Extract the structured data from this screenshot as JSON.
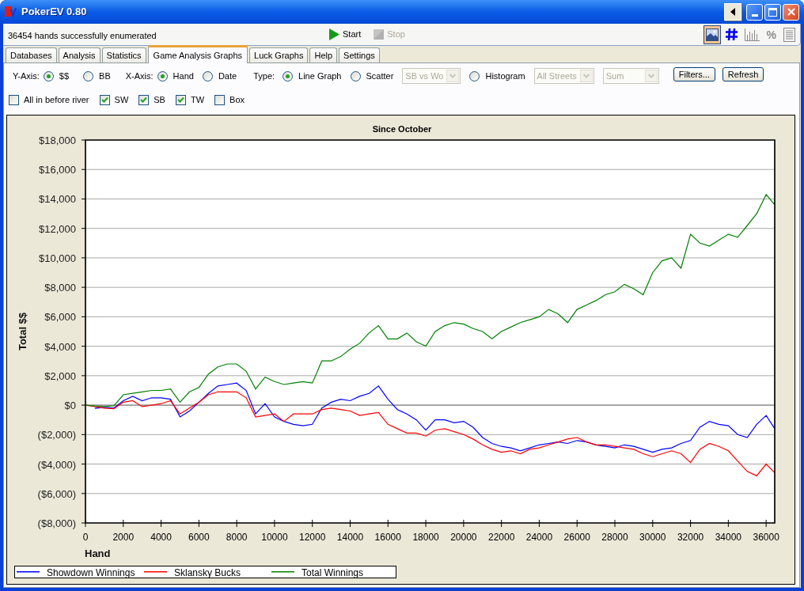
{
  "window": {
    "title": "PokerEV 0.80"
  },
  "status_bar": {
    "message": "36454 hands successfully enumerated",
    "actions": [
      {
        "kind": "start",
        "label": "Start",
        "disabled": false
      },
      {
        "kind": "stop",
        "label": "Stop",
        "disabled": true
      }
    ],
    "view_buttons": [
      {
        "kind": "picture",
        "selected": true
      },
      {
        "kind": "hash",
        "selected": false
      },
      {
        "kind": "bars",
        "selected": false
      },
      {
        "kind": "percent",
        "label": "%",
        "selected": false
      },
      {
        "kind": "list",
        "selected": false
      }
    ]
  },
  "tabs": [
    {
      "label": "Databases",
      "selected": false
    },
    {
      "label": "Analysis",
      "selected": false
    },
    {
      "label": "Statistics",
      "selected": false
    },
    {
      "label": "Game Analysis Graphs",
      "selected": true
    },
    {
      "label": "Luck Graphs",
      "selected": false
    },
    {
      "label": "Help",
      "selected": false
    },
    {
      "label": "Settings",
      "selected": false
    }
  ],
  "graph_options": {
    "y_axis": {
      "label": "Y-Axis:",
      "options": [
        {
          "label": "$$",
          "selected": true
        },
        {
          "label": "BB",
          "selected": false
        }
      ]
    },
    "x_axis": {
      "label": "X-Axis:",
      "options": [
        {
          "label": "Hand",
          "selected": true
        },
        {
          "label": "Date",
          "selected": false
        }
      ]
    },
    "type": {
      "label": "Type:",
      "controls": [
        {
          "kind": "radio",
          "label": "Line Graph",
          "selected": true
        },
        {
          "kind": "radio",
          "label": "Scatter",
          "selected": false
        },
        {
          "kind": "dropdown",
          "value": "SB vs Wo",
          "disabled": true
        },
        {
          "kind": "radio",
          "label": "Histogram",
          "selected": false
        },
        {
          "kind": "dropdown",
          "value": "All Streets",
          "disabled": true
        },
        {
          "kind": "dropdown",
          "value": "Sum",
          "disabled": true
        }
      ]
    },
    "buttons": [
      {
        "label": "Filters..."
      },
      {
        "label": "Refresh"
      }
    ],
    "checkboxes": [
      {
        "label": "All in before river",
        "checked": false
      },
      {
        "label": "SW",
        "checked": true
      },
      {
        "label": "SB",
        "checked": true
      },
      {
        "label": "TW",
        "checked": true
      },
      {
        "label": "Box",
        "checked": false
      }
    ]
  },
  "chart": {
    "chart_data": {
      "type": "line",
      "title": "Since October",
      "xlabel": "Hand",
      "ylabel": "Total $$",
      "grid": true,
      "legend": "bottom",
      "x": [
        0,
        500,
        1000,
        1500,
        2000,
        2500,
        3000,
        3500,
        4000,
        4500,
        5000,
        5500,
        6000,
        6500,
        7000,
        7500,
        8000,
        8500,
        9000,
        9500,
        10000,
        10500,
        11000,
        11500,
        12000,
        12500,
        13000,
        13500,
        14000,
        14500,
        15000,
        15500,
        16000,
        16500,
        17000,
        17500,
        18000,
        18500,
        19000,
        19500,
        20000,
        20500,
        21000,
        21500,
        22000,
        22500,
        23000,
        23500,
        24000,
        24500,
        25000,
        25500,
        26000,
        26500,
        27000,
        27500,
        28000,
        28500,
        29000,
        29500,
        30000,
        30500,
        31000,
        31500,
        32000,
        32500,
        33000,
        33500,
        34000,
        34500,
        35000,
        35500,
        36000,
        36454
      ],
      "series": [
        {
          "name": "Showdown Winnings",
          "color": "#0000ff",
          "values": [
            null,
            -220,
            -150,
            -200,
            300,
            600,
            300,
            500,
            500,
            400,
            -800,
            -400,
            200,
            800,
            1300,
            1400,
            1500,
            1000,
            -600,
            100,
            -800,
            -1100,
            -1300,
            -1400,
            -1300,
            -200,
            200,
            400,
            300,
            600,
            800,
            1300,
            400,
            -300,
            -600,
            -1000,
            -1700,
            -1000,
            -1000,
            -1200,
            -1100,
            -1500,
            -2200,
            -2600,
            -2800,
            -2900,
            -3100,
            -2900,
            -2700,
            -2600,
            -2500,
            -2600,
            -2400,
            -2500,
            -2700,
            -2800,
            -2900,
            -2700,
            -2800,
            -3000,
            -3200,
            -3000,
            -2900,
            -2600,
            -2400,
            -1500,
            -1100,
            -1300,
            -1400,
            -2000,
            -2200,
            -1300,
            -700,
            -1600
          ]
        },
        {
          "name": "Sklansky Bucks",
          "color": "#ff0000",
          "values": [
            0,
            -100,
            -200,
            -250,
            200,
            300,
            -100,
            0,
            100,
            300,
            -600,
            -200,
            200,
            700,
            900,
            900,
            900,
            500,
            -800,
            -700,
            -600,
            -1100,
            -600,
            -600,
            -600,
            -300,
            -200,
            -300,
            -400,
            -700,
            -600,
            -500,
            -1300,
            -1600,
            -1900,
            -1900,
            -2100,
            -1700,
            -1600,
            -1800,
            -2000,
            -2300,
            -2700,
            -3000,
            -3200,
            -3100,
            -3300,
            -3000,
            -2900,
            -2700,
            -2500,
            -2300,
            -2200,
            -2500,
            -2700,
            -2700,
            -2800,
            -2900,
            -3000,
            -3300,
            -3500,
            -3300,
            -3100,
            -3300,
            -3900,
            -3000,
            -2600,
            -2800,
            -3100,
            -3800,
            -4500,
            -4800,
            -4000,
            -4600
          ]
        },
        {
          "name": "Total Winnings",
          "color": "#008000",
          "values": [
            0,
            -50,
            -100,
            -50,
            700,
            800,
            900,
            1000,
            1000,
            1100,
            200,
            900,
            1200,
            2100,
            2600,
            2800,
            2800,
            2300,
            1100,
            1900,
            1600,
            1400,
            1500,
            1600,
            1500,
            3000,
            3000,
            3300,
            3800,
            4200,
            4900,
            5400,
            4500,
            4500,
            4900,
            4300,
            4000,
            5000,
            5400,
            5600,
            5500,
            5200,
            5000,
            4500,
            5000,
            5300,
            5600,
            5800,
            6000,
            6500,
            6200,
            5600,
            6500,
            6800,
            7100,
            7500,
            7700,
            8200,
            7900,
            7500,
            9000,
            9800,
            10000,
            9300,
            11600,
            11000,
            10800,
            11200,
            11600,
            11400,
            12200,
            13000,
            14300,
            13600
          ]
        }
      ],
      "xlim": [
        0,
        36454
      ],
      "ylim": [
        -8000,
        18000
      ],
      "xticks": [
        0,
        2000,
        4000,
        6000,
        8000,
        10000,
        12000,
        14000,
        16000,
        18000,
        20000,
        22000,
        24000,
        26000,
        28000,
        30000,
        32000,
        34000,
        36000
      ],
      "yticks": [
        {
          "value": 18000,
          "label": "$18,000"
        },
        {
          "value": 16000,
          "label": "$16,000"
        },
        {
          "value": 14000,
          "label": "$14,000"
        },
        {
          "value": 12000,
          "label": "$12,000"
        },
        {
          "value": 10000,
          "label": "$10,000"
        },
        {
          "value": 8000,
          "label": "$8,000"
        },
        {
          "value": 6000,
          "label": "$6,000"
        },
        {
          "value": 4000,
          "label": "$4,000"
        },
        {
          "value": 2000,
          "label": "$2,000"
        },
        {
          "value": 0,
          "label": "$0"
        },
        {
          "value": -2000,
          "label": "($2,000)"
        },
        {
          "value": -4000,
          "label": "($4,000)"
        },
        {
          "value": -6000,
          "label": "($6,000)"
        },
        {
          "value": -8000,
          "label": "($8,000)"
        }
      ]
    }
  }
}
